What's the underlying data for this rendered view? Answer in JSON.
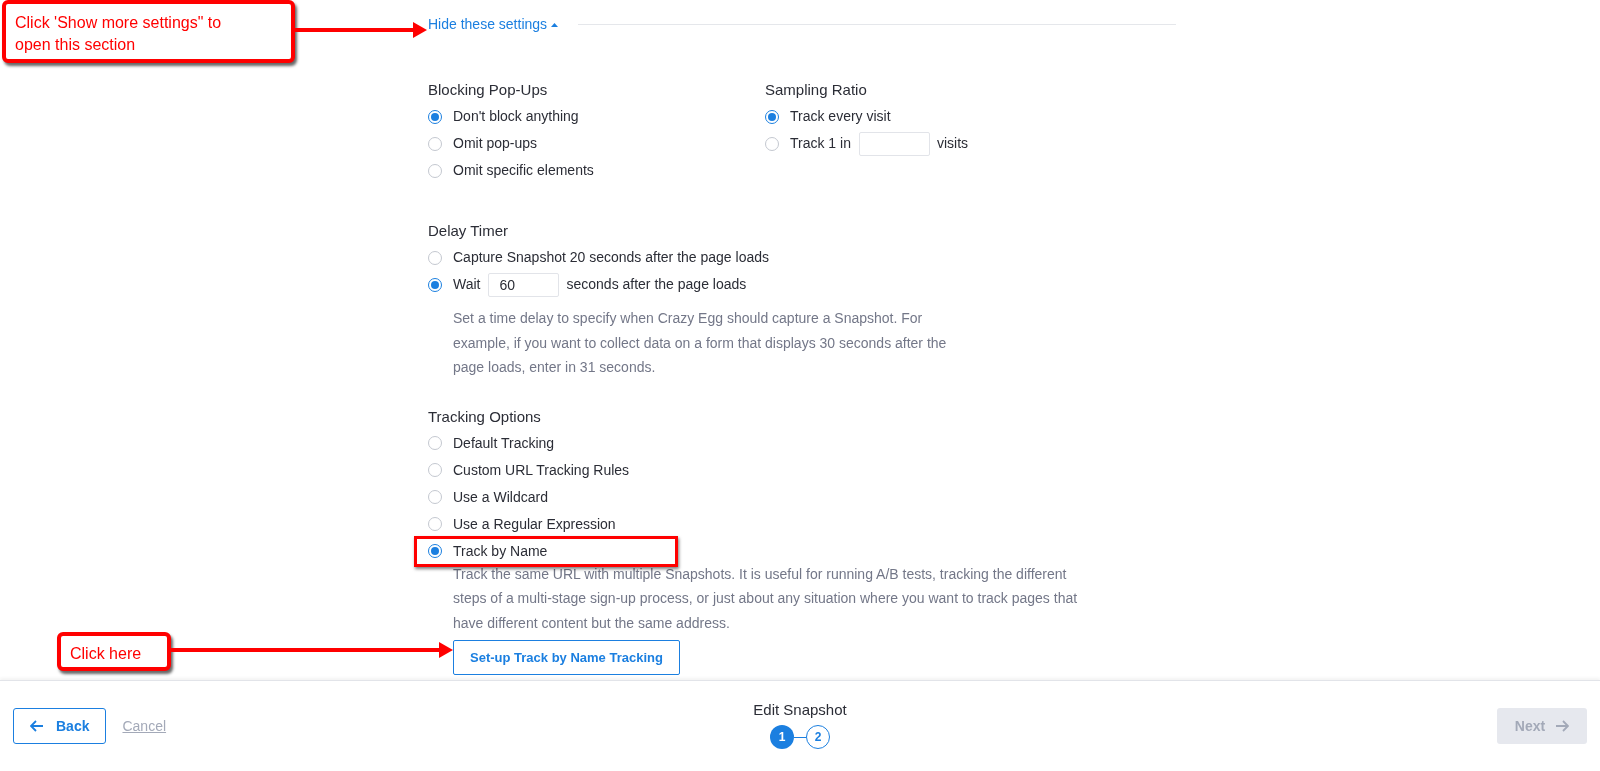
{
  "toggle_link": {
    "label": "Hide these settings",
    "expanded": true
  },
  "blocking_popups": {
    "title": "Blocking Pop-Ups",
    "options": [
      {
        "label": "Don't block anything",
        "selected": true
      },
      {
        "label": "Omit pop-ups",
        "selected": false
      },
      {
        "label": "Omit specific elements",
        "selected": false
      }
    ]
  },
  "sampling_ratio": {
    "title": "Sampling Ratio",
    "options": [
      {
        "kind": "plain",
        "label": "Track every visit",
        "selected": true
      },
      {
        "kind": "input",
        "label": "Track 1 in",
        "suffix": "visits",
        "selected": false
      }
    ]
  },
  "delay_timer": {
    "title": "Delay Timer",
    "options": [
      {
        "kind": "plain",
        "label": "Capture Snapshot 20 seconds after the page loads",
        "selected": false
      },
      {
        "kind": "input",
        "label": "Wait",
        "value": "60",
        "suffix": "seconds after the page loads",
        "selected": true
      }
    ],
    "help": "Set a time delay to specify when Crazy Egg should capture a Snapshot. For example, if you want to collect data on a form that displays 30 seconds after the page loads, enter in 31 seconds."
  },
  "tracking_options": {
    "title": "Tracking Options",
    "options": [
      {
        "label": "Default Tracking",
        "selected": false
      },
      {
        "label": "Custom URL Tracking Rules",
        "selected": false
      },
      {
        "label": "Use a Wildcard",
        "selected": false
      },
      {
        "label": "Use a Regular Expression",
        "selected": false
      },
      {
        "label": "Track by Name",
        "selected": true
      }
    ],
    "help": "Track the same URL with multiple Snapshots. It is useful for running A/B tests, tracking the different steps of a multi-stage sign-up process, or just about any situation where you want to track pages that have different content but the same address.",
    "action_button": "Set-up Track by Name Tracking"
  },
  "footer": {
    "back": "Back",
    "cancel": "Cancel",
    "title": "Edit Snapshot",
    "steps": [
      {
        "label": "1",
        "selected": true
      },
      {
        "label": "2",
        "selected": false
      }
    ],
    "next": {
      "label": "Next",
      "disabled": true
    }
  },
  "annotations": [
    {
      "kind": "callout",
      "text": "Click 'Show more settings\" to open this section"
    },
    {
      "kind": "callout",
      "text": "Click here"
    },
    {
      "kind": "highlight"
    }
  ]
}
